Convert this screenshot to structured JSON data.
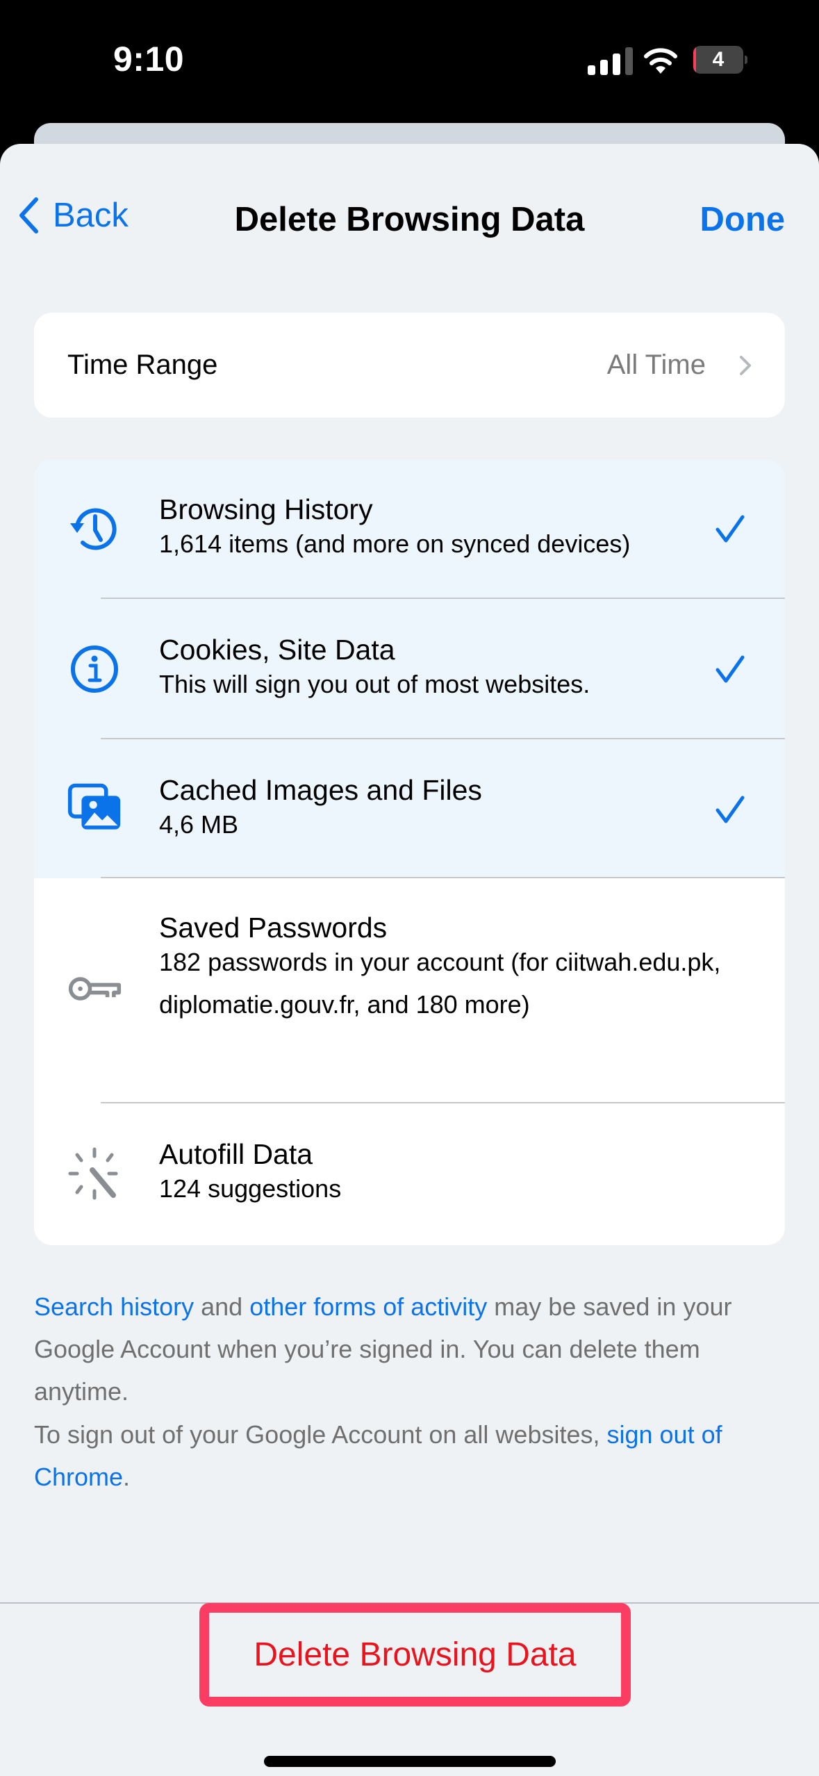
{
  "status_bar": {
    "time": "9:10",
    "battery_level": "4",
    "icons": [
      "signal-icon",
      "wifi-icon",
      "battery-icon"
    ]
  },
  "nav": {
    "back_label": "Back",
    "title": "Delete Browsing Data",
    "done_label": "Done"
  },
  "time_range": {
    "label": "Time Range",
    "value": "All Time"
  },
  "data_types": [
    {
      "title": "Browsing History",
      "subtitle": "1,614 items (and more on synced devices)",
      "icon": "history-icon",
      "selected": true
    },
    {
      "title": "Cookies, Site Data",
      "subtitle": "This will sign you out of most websites.",
      "icon": "info-icon",
      "selected": true
    },
    {
      "title": "Cached Images and Files",
      "subtitle": "4,6 MB",
      "icon": "images-icon",
      "selected": true
    },
    {
      "title": "Saved Passwords",
      "subtitle": "182 passwords in your account (for ciitwah.edu.pk, diplomatie.gouv.fr, and 180 more)",
      "icon": "key-icon",
      "selected": false
    },
    {
      "title": "Autofill Data",
      "subtitle": "124 suggestions",
      "icon": "autofill-wand-icon",
      "selected": false
    }
  ],
  "footer": {
    "p1_link1": "Search history",
    "p1_text1": " and ",
    "p1_link2": "other forms of activity",
    "p1_text2": " may be saved in your Google Account when you’re signed in. You can delete them anytime.",
    "p2_text": "To sign out of your Google Account on all websites, ",
    "p2_link": "sign out of Chrome",
    "p2_end": "."
  },
  "delete_button_label": "Delete Browsing Data",
  "colors": {
    "accent": "#0b73ea",
    "destructive": "#e8131c",
    "highlight_border": "#fc3d63",
    "selected_row_bg": "#eef6fd",
    "sheet_bg": "#eff2f4"
  }
}
